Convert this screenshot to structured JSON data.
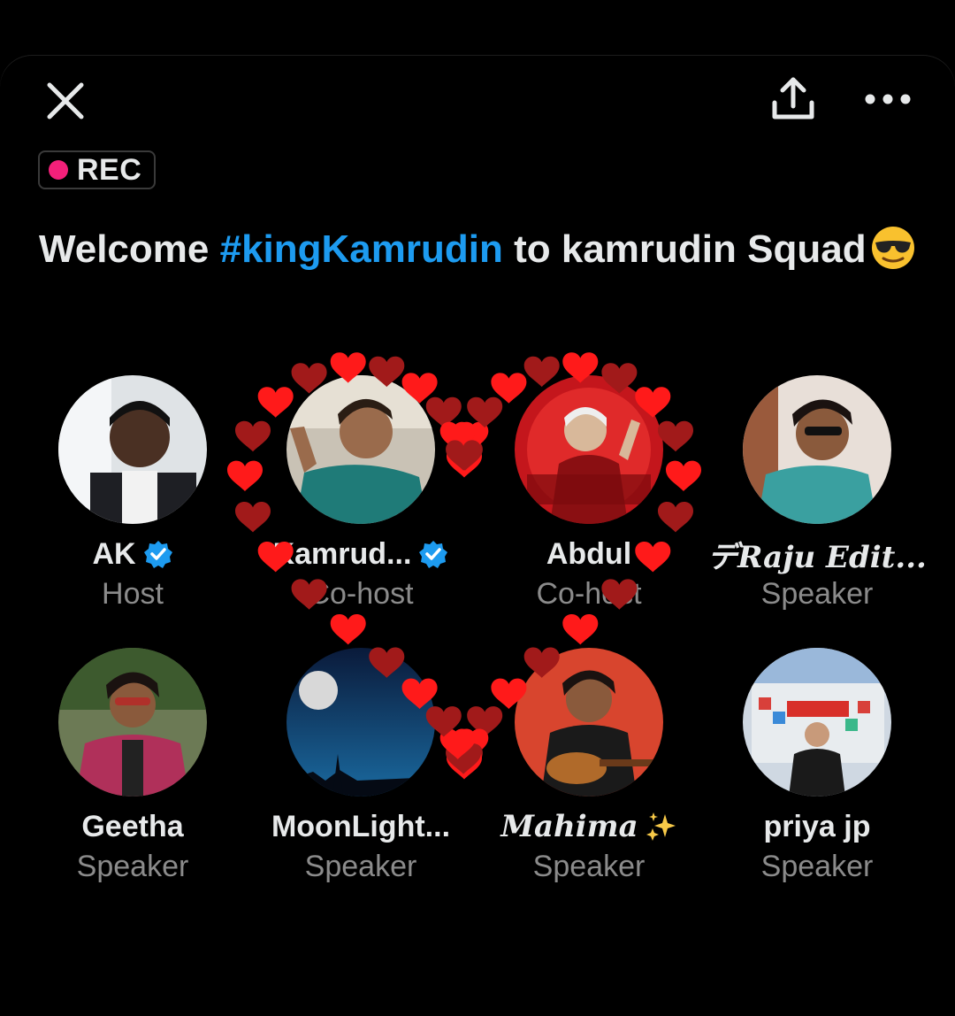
{
  "header": {
    "close_icon": "close-icon",
    "share_icon": "share-icon",
    "more_icon": "more-icon"
  },
  "recording": {
    "label": "REC",
    "dot_color": "#f4207a"
  },
  "space": {
    "title_prefix": "Welcome ",
    "title_hashtag": "#kingKamrudin",
    "title_suffix": " to kamrudin Squad",
    "title_emoji": "sunglasses-emoji",
    "hashtag_color": "#1d9bf0"
  },
  "participants": [
    {
      "name": "AK",
      "role": "Host",
      "verified": true
    },
    {
      "name": "Kamrud...",
      "role": "Co-host",
      "verified": true
    },
    {
      "name": "Abdul",
      "role": "Co-host",
      "verified": false
    },
    {
      "name": "デRaju Edit...",
      "role": "Speaker",
      "verified": false
    },
    {
      "name": "Geetha",
      "role": "Speaker",
      "verified": false
    },
    {
      "name": "MoonLight...",
      "role": "Speaker",
      "verified": false
    },
    {
      "name": "Mahima",
      "role": "Speaker",
      "verified": false,
      "suffix_emoji": "sparkles-emoji"
    },
    {
      "name": "priya jp",
      "role": "Speaker",
      "verified": false
    }
  ],
  "decoration": {
    "heart_color_bright": "#ff1a1a",
    "heart_color_dark": "#a11a1a"
  }
}
